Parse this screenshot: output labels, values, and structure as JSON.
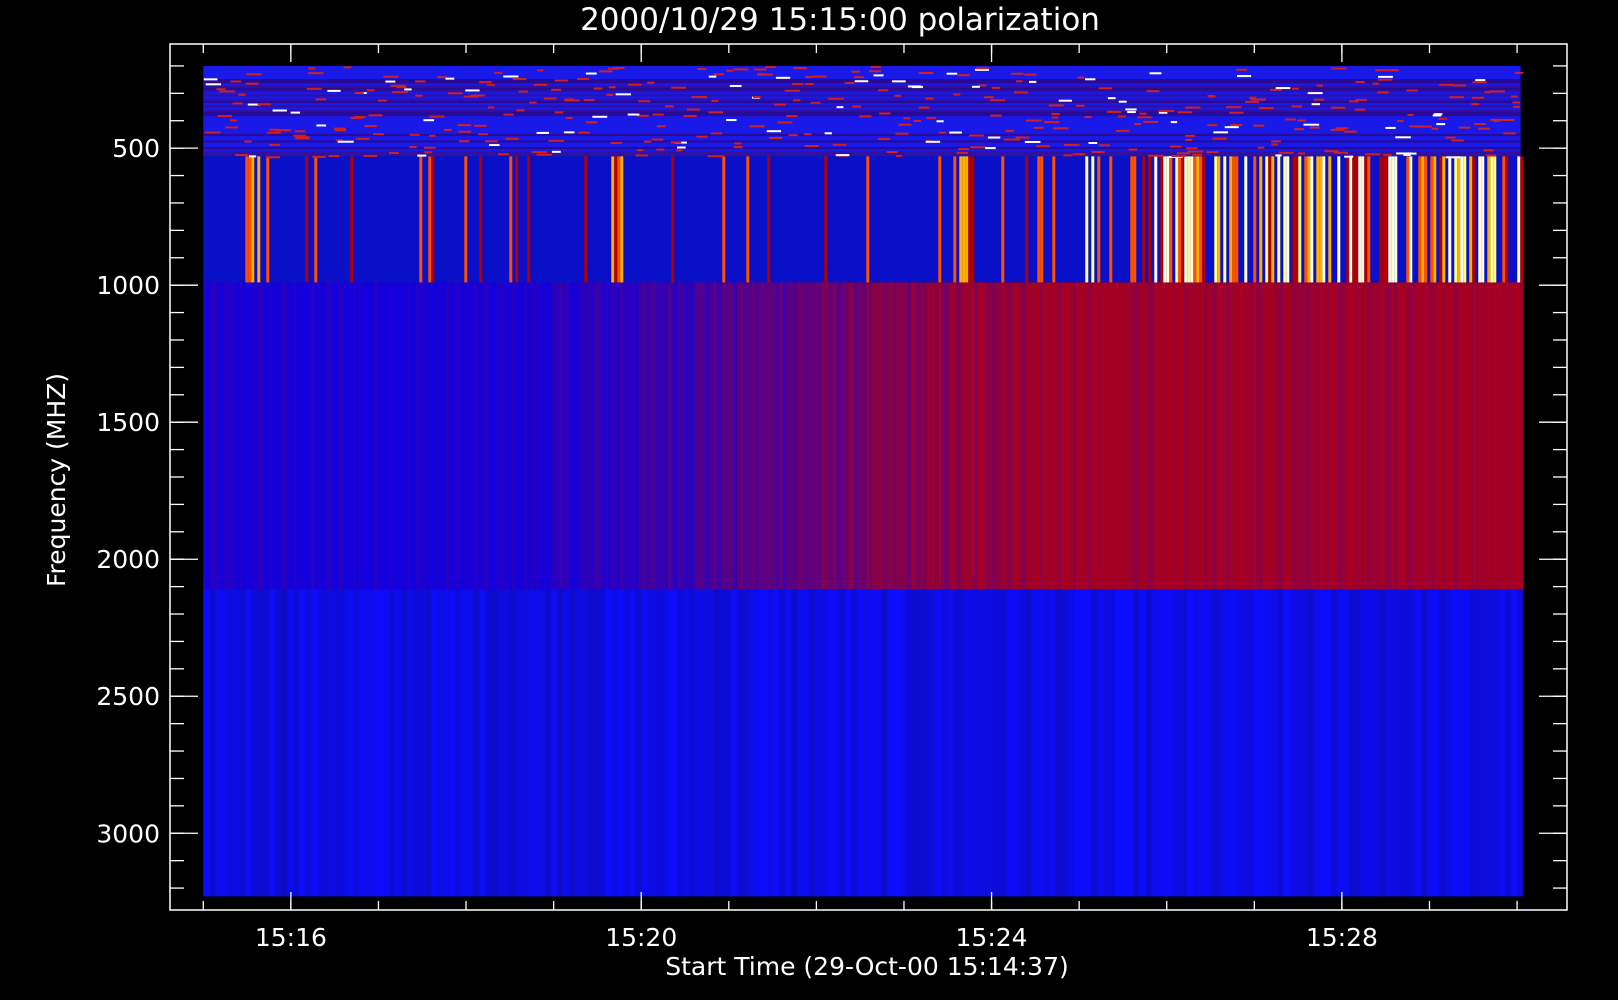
{
  "chart_data": {
    "type": "heatmap",
    "title": "2000/10/29 15:15:00 polarization",
    "xlabel": "Start Time (29-Oct-00 15:14:37)",
    "ylabel": "Frequency (MHZ)",
    "x_axis": {
      "unit": "minutes after 15:14:37",
      "range": [
        0,
        15.95
      ],
      "data_range": [
        0.38,
        15.42
      ],
      "ticks": [
        {
          "value": 1.38,
          "label": "15:16"
        },
        {
          "value": 5.38,
          "label": "15:20"
        },
        {
          "value": 9.38,
          "label": "15:24"
        },
        {
          "value": 13.38,
          "label": "15:28"
        }
      ],
      "minor_step": 1
    },
    "y_axis": {
      "unit": "MHz",
      "inverted": true,
      "range": [
        120,
        3280
      ],
      "ticks": [
        500,
        1000,
        1500,
        2000,
        2500,
        3000
      ],
      "minor_step": 100
    },
    "colormap": "blue-red-yellow-white",
    "colors": {
      "background": "#000000",
      "low": "#0a0ad0",
      "mid": "#b00000",
      "high": "#ffffa0"
    },
    "bands": [
      {
        "freq_range": [
          200,
          530
        ],
        "pattern": "dense fine structure, periodic red/white flecks"
      },
      {
        "freq_range": [
          530,
          990
        ],
        "pattern": "broadband bursts, strongest after 15:24"
      },
      {
        "freq_range": [
          990,
          2110
        ],
        "pattern": "blue before 15:20, increasingly red after"
      },
      {
        "freq_range": [
          2110,
          3230
        ],
        "pattern": "uniform blue"
      }
    ],
    "burst_intervals_min": [
      [
        0.85,
        1.0
      ],
      [
        5.0,
        5.2
      ],
      [
        9.0,
        9.2
      ],
      [
        11.2,
        11.6
      ],
      [
        13.8,
        14.0
      ],
      [
        14.8,
        15.0
      ]
    ]
  }
}
